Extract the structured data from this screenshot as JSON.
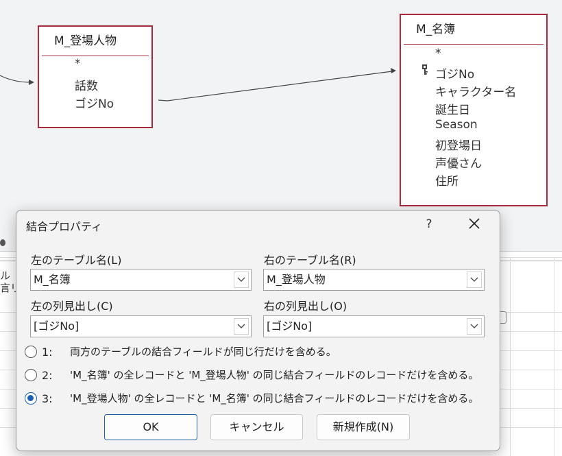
{
  "tables": {
    "toujou": {
      "title": "M_登場人物",
      "fields": [
        "*",
        "話数",
        "ゴジNo"
      ]
    },
    "meibo": {
      "title": "M_名簿",
      "fields": [
        "*",
        "ゴジNo",
        "キャラクター名",
        "誕生日",
        "Season",
        "初登場日",
        "声優さん",
        "住所"
      ]
    }
  },
  "grid_side_text": [
    "ル",
    "言リ"
  ],
  "dialog": {
    "title": "結合プロパティ",
    "help": "?",
    "left_table_label": "左のテーブル名(L)",
    "right_table_label": "右のテーブル名(R)",
    "left_table_value": "M_名簿",
    "right_table_value": "M_登場人物",
    "left_column_label": "左の列見出し(C)",
    "right_column_label": "右の列見出し(O)",
    "left_column_value": "[ゴジNo]",
    "right_column_value": "[ゴジNo]",
    "options": [
      {
        "num": "1:",
        "text": "両方のテーブルの結合フィールドが同じ行だけを含める。",
        "checked": false
      },
      {
        "num": "2:",
        "text": "'M_名簿' の全レコードと 'M_登場人物' の同じ結合フィールドのレコードだけを含める。",
        "checked": false
      },
      {
        "num": "3:",
        "text": "'M_登場人物' の全レコードと 'M_名簿' の同じ結合フィールドのレコードだけを含める。",
        "checked": true
      }
    ],
    "buttons": {
      "ok": "OK",
      "cancel": "キャンセル",
      "new": "新規作成(N)"
    }
  },
  "colors": {
    "table_border": "#a8283c",
    "accent": "#1a5fb4"
  }
}
